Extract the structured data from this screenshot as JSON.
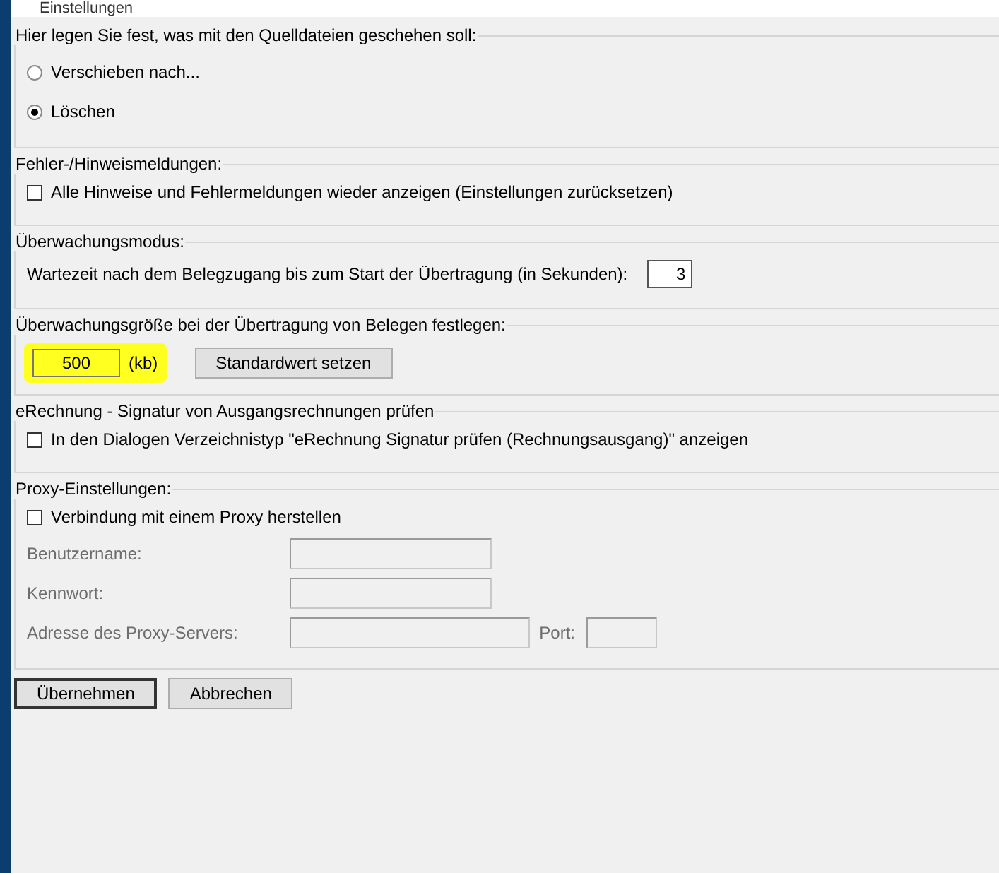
{
  "window": {
    "title": "Einstellungen"
  },
  "sections": [
    {
      "kind": "radios",
      "legend": "Hier legen Sie fest, was mit den Quelldateien geschehen soll:",
      "options": [
        {
          "label": "Verschieben nach...",
          "selected": false
        },
        {
          "label": "Löschen",
          "selected": true
        }
      ]
    },
    {
      "kind": "checkbox",
      "legend": "Fehler-/Hinweismeldungen:",
      "label": "Alle Hinweise und Fehlermeldungen wieder anzeigen (Einstellungen zurücksetzen)",
      "checked": false
    },
    {
      "kind": "number",
      "legend": "Überwachungsmodus:",
      "label": "Wartezeit nach dem Belegzugang bis zum Start der Übertragung (in Sekunden):",
      "value": "3"
    },
    {
      "kind": "size",
      "legend": "Überwachungsgröße bei der Übertragung von Belegen festlegen:",
      "value": "500",
      "unit": "(kb)",
      "highlighted": true,
      "button": "Standardwert setzen"
    },
    {
      "kind": "checkbox",
      "legend": "eRechnung - Signatur von Ausgangsrechnungen prüfen",
      "label": "In den Dialogen Verzeichnistyp \"eRechnung Signatur prüfen (Rechnungsausgang)\" anzeigen",
      "checked": false
    },
    {
      "kind": "proxy",
      "legend": "Proxy-Einstellungen:",
      "label": "Verbindung mit einem Proxy herstellen",
      "checked": false,
      "fields": [
        {
          "label": "Benutzername:",
          "disabled": true
        },
        {
          "label": "Kennwort:",
          "disabled": true
        },
        {
          "label": "Adresse des Proxy-Servers:",
          "disabled": true
        }
      ],
      "port": {
        "label": "Port:",
        "disabled": true
      }
    }
  ],
  "buttons": [
    {
      "label": "Übernehmen",
      "selected": true
    },
    {
      "label": "Abbrechen",
      "selected": false
    }
  ]
}
